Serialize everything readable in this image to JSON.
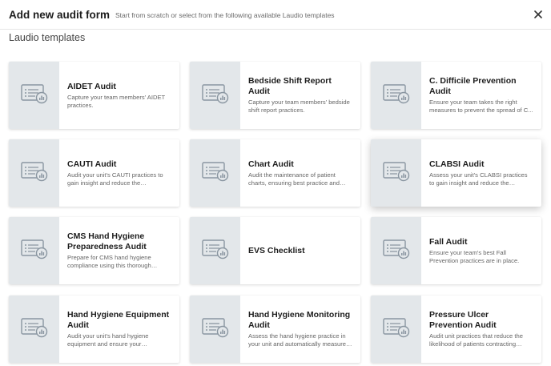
{
  "header": {
    "title": "Add new audit form",
    "subtitle": "Start from scratch or select from the following available Laudio templates"
  },
  "section": {
    "title": "Laudio templates"
  },
  "icon": "form-template-icon",
  "templates": [
    {
      "title": "AIDET Audit",
      "description": "Capture your team members' AIDET practices."
    },
    {
      "title": "Bedside Shift Report Audit",
      "description": "Capture your team members' bedside shift report practices."
    },
    {
      "title": "C. Difficile Prevention Audit",
      "description": "Ensure your team takes the right measures to prevent the spread of C..."
    },
    {
      "title": "CAUTI Audit",
      "description": "Audit your unit's CAUTI practices to gain insight and reduce the likelihood..."
    },
    {
      "title": "Chart Audit",
      "description": "Audit the maintenance of patient charts, ensuring best practice and me..."
    },
    {
      "title": "CLABSI Audit",
      "description": "Assess your unit's CLABSI practices to gain insight and reduce the likelihood..."
    },
    {
      "title": "CMS Hand Hygiene Preparedness Audit",
      "description": "Prepare for CMS hand hygiene compliance using this thorough asses..."
    },
    {
      "title": "EVS Checklist",
      "description": ""
    },
    {
      "title": "Fall Audit",
      "description": "Ensure your team's best Fall Prevention practices are in place."
    },
    {
      "title": "Hand Hygiene Equipment Audit",
      "description": "Audit your unit's hand hygiene equipment and ensure your standards..."
    },
    {
      "title": "Hand Hygiene Monitoring Audit",
      "description": "Assess the hand hygiene practice in your unit and automatically measure o..."
    },
    {
      "title": "Pressure Ulcer Prevention Audit",
      "description": "Audit unit practices that reduce the likelihood of patients contracting pres..."
    }
  ]
}
